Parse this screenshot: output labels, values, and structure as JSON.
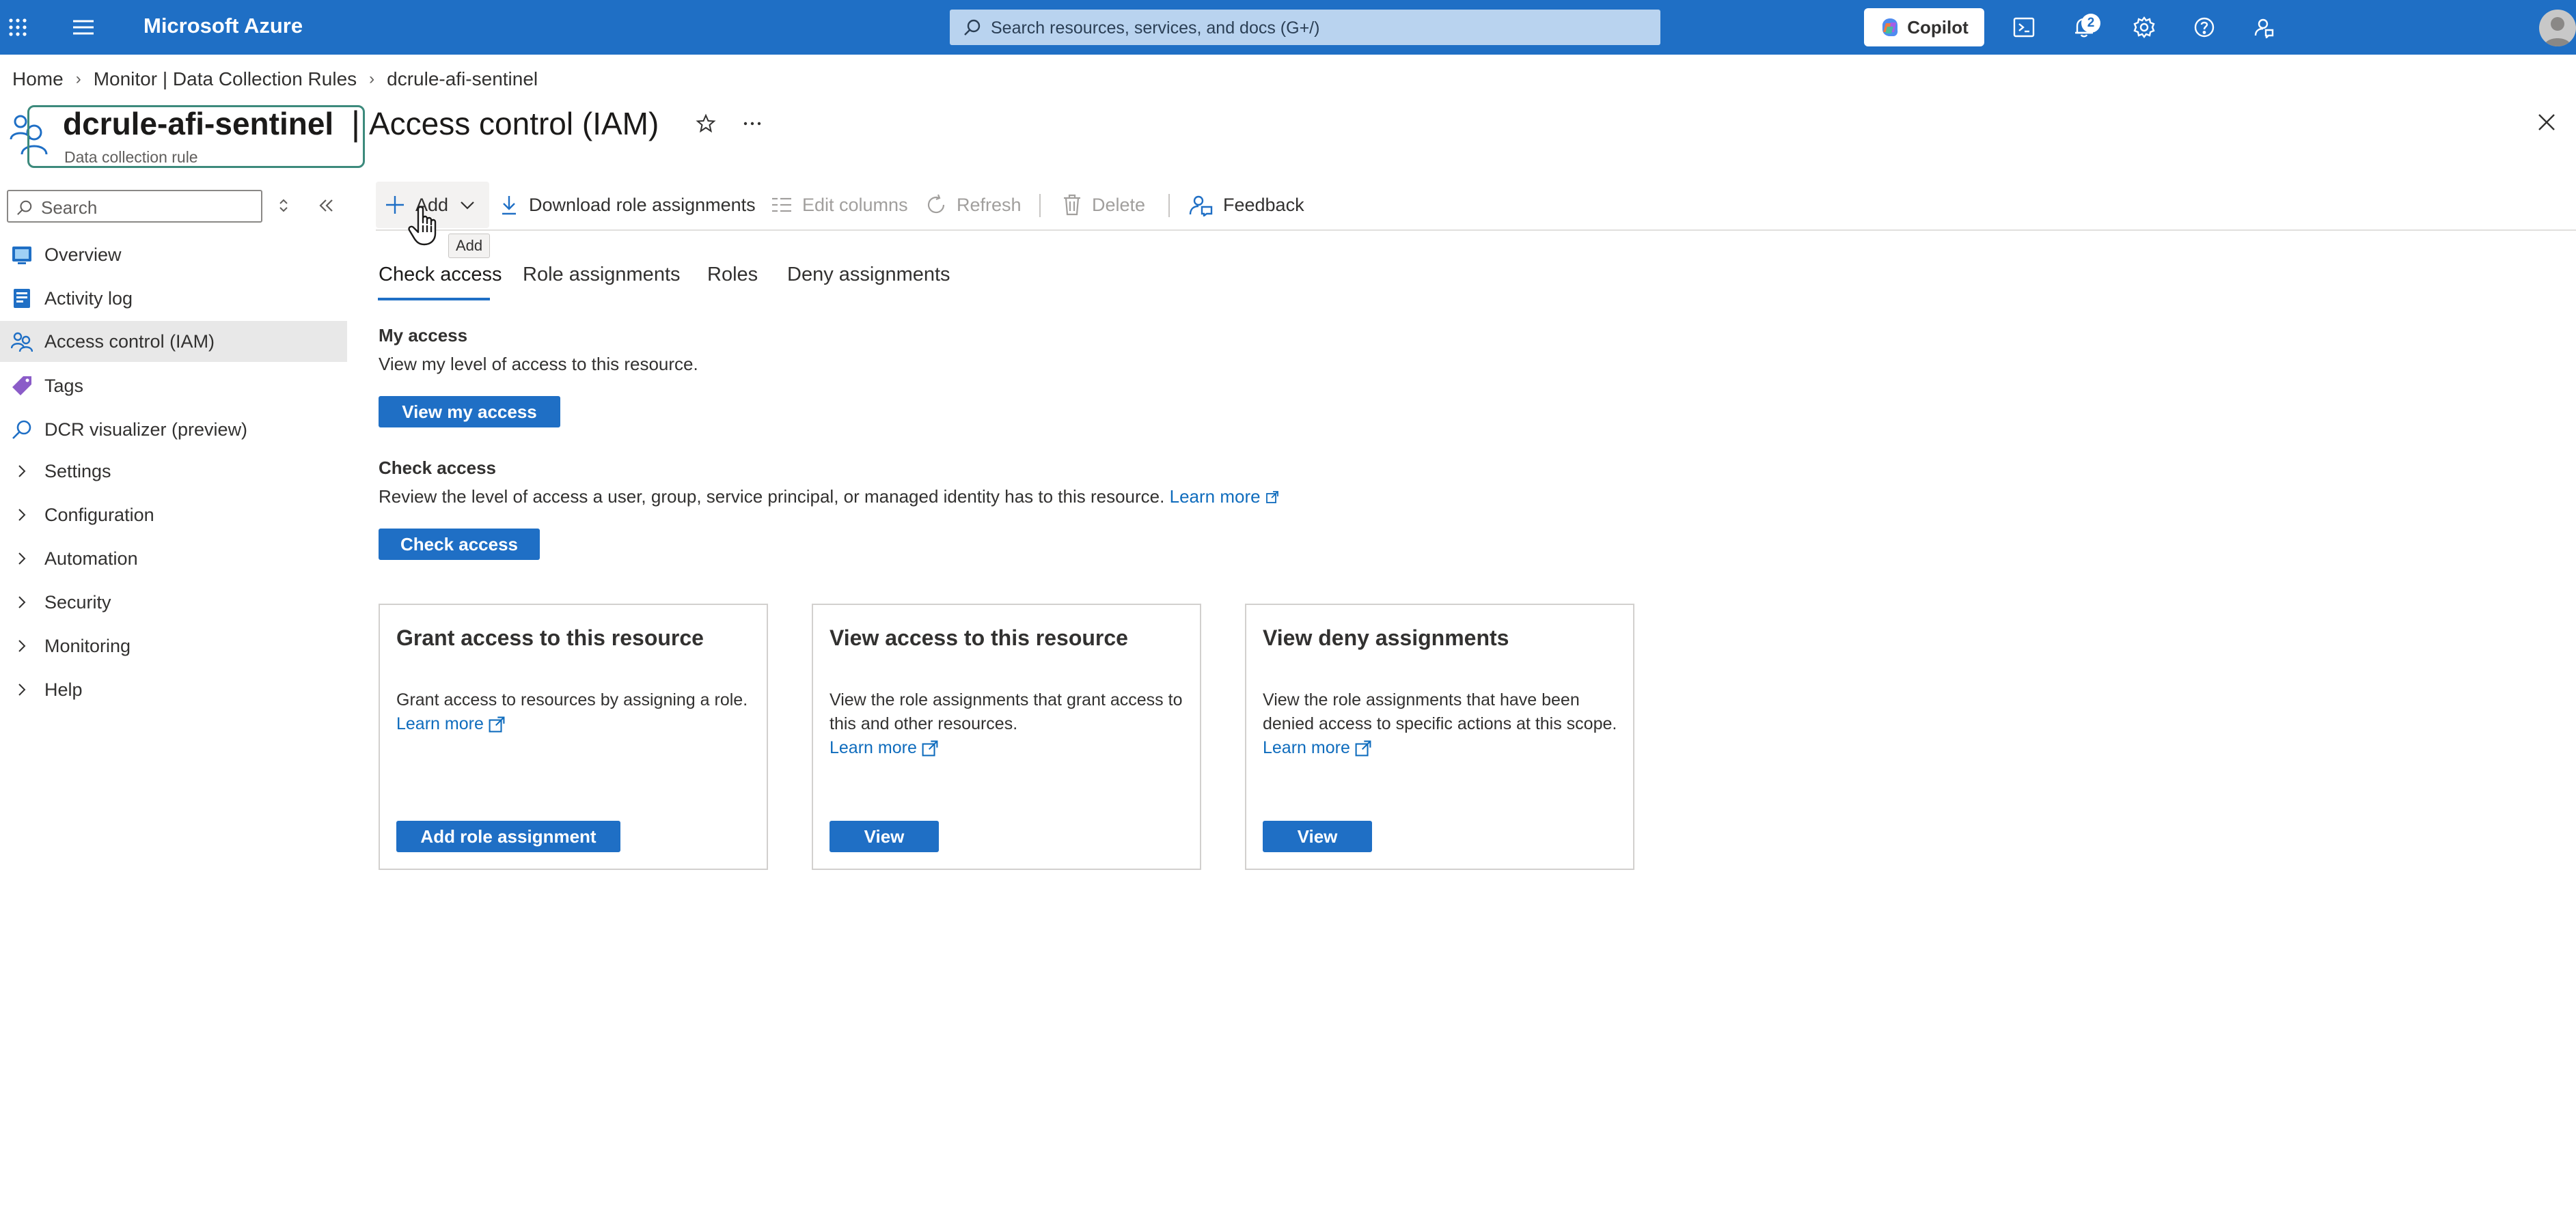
{
  "topbar": {
    "app_title": "Microsoft Azure",
    "search_placeholder": "Search resources, services, and docs (G+/)",
    "copilot_label": "Copilot",
    "notifications_count": "2",
    "icons": [
      "app-launcher-icon",
      "hamburger-menu-icon",
      "search-icon",
      "copilot-icon",
      "cloud-shell-icon",
      "notifications-icon",
      "settings-gear-icon",
      "help-icon",
      "feedback-icon",
      "user-avatar"
    ]
  },
  "breadcrumb": {
    "items": [
      "Home",
      "Monitor | Data Collection Rules",
      "dcrule-afi-sentinel"
    ]
  },
  "header": {
    "resource_name": "dcrule-afi-sentinel",
    "separator": "|",
    "page_title": "Access control (IAM)",
    "resource_type": "Data collection rule"
  },
  "sidebar": {
    "search_placeholder": "Search",
    "items": [
      {
        "label": "Overview",
        "icon": "overview-icon"
      },
      {
        "label": "Activity log",
        "icon": "activity-log-icon"
      },
      {
        "label": "Access control (IAM)",
        "icon": "iam-icon",
        "active": true
      },
      {
        "label": "Tags",
        "icon": "tag-icon"
      },
      {
        "label": "DCR visualizer (preview)",
        "icon": "search-icon"
      },
      {
        "label": "Settings",
        "icon": "chevron-right-icon"
      },
      {
        "label": "Configuration",
        "icon": "chevron-right-icon"
      },
      {
        "label": "Automation",
        "icon": "chevron-right-icon"
      },
      {
        "label": "Security",
        "icon": "chevron-right-icon"
      },
      {
        "label": "Monitoring",
        "icon": "chevron-right-icon"
      },
      {
        "label": "Help",
        "icon": "chevron-right-icon"
      }
    ]
  },
  "commandbar": {
    "add": "Add",
    "download": "Download role assignments",
    "edit_columns": "Edit columns",
    "refresh": "Refresh",
    "delete": "Delete",
    "feedback": "Feedback",
    "tooltip": "Add"
  },
  "tabs": [
    "Check access",
    "Role assignments",
    "Roles",
    "Deny assignments"
  ],
  "my_access": {
    "heading": "My access",
    "description": "View my level of access to this resource.",
    "button": "View my access"
  },
  "check_access": {
    "heading": "Check access",
    "description": "Review the level of access a user, group, service principal, or managed identity has to this resource.",
    "link": "Learn more",
    "button": "Check access"
  },
  "cards": [
    {
      "title": "Grant access to this resource",
      "description": "Grant access to resources by assigning a role.",
      "link": "Learn more",
      "button": "Add role assignment"
    },
    {
      "title": "View access to this resource",
      "description": "View the role assignments that grant access to this and other resources.",
      "link": "Learn more",
      "button": "View"
    },
    {
      "title": "View deny assignments",
      "description": "View the role assignments that have been denied access to specific actions at this scope.",
      "link": "Learn more",
      "button": "View"
    }
  ],
  "colors": {
    "brand": "#1f6fc5",
    "link": "#0f6cbd",
    "text": "#323130"
  }
}
